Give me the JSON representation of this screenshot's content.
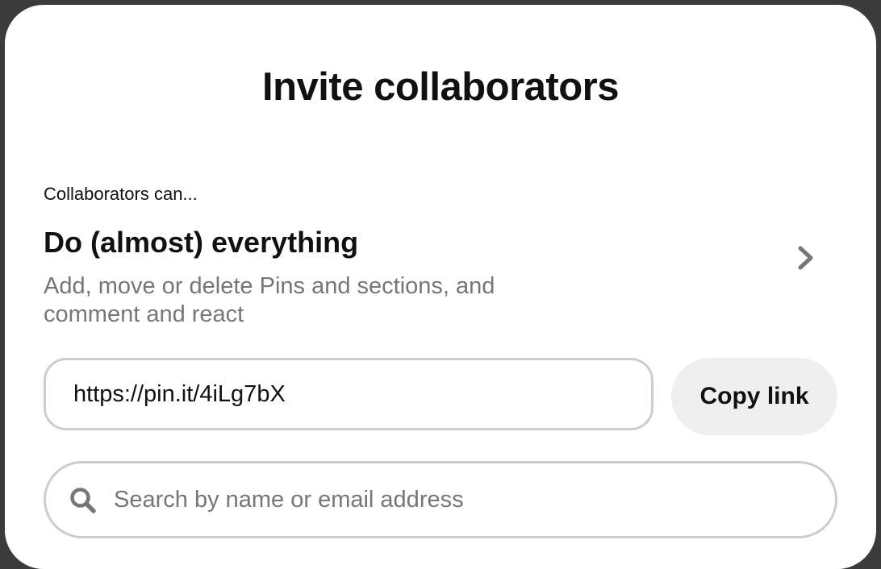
{
  "modal": {
    "title": "Invite collaborators"
  },
  "permissions": {
    "caption": "Collaborators can...",
    "level_title": "Do (almost) everything",
    "level_description": "Add, move or delete Pins and sections, and comment and react",
    "chevron_icon": "chevron-right-icon"
  },
  "share_link": {
    "value": "https://pin.it/4iLg7bX",
    "copy_label": "Copy link"
  },
  "search": {
    "icon": "search-icon",
    "placeholder": "Search by name or email address",
    "value": ""
  },
  "colors": {
    "backdrop": "#3b3b3b",
    "surface": "#ffffff",
    "text_primary": "#111111",
    "text_secondary": "#767676",
    "border": "#cdcdcd",
    "button_bg": "#efefef"
  }
}
